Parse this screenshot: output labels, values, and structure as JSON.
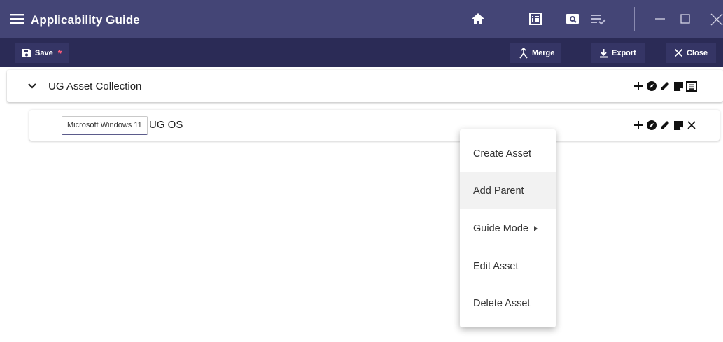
{
  "window": {
    "title": "Applicability Guide"
  },
  "toolbar": {
    "save_label": "Save",
    "unsaved_marker": "*",
    "merge_label": "Merge",
    "export_label": "Export",
    "close_label": "Close"
  },
  "tree": {
    "root": {
      "label": "UG Asset Collection"
    },
    "child": {
      "chip": "Microsoft Windows 11",
      "label": "UG OS"
    }
  },
  "context_menu": {
    "items": [
      {
        "label": "Create Asset"
      },
      {
        "label": "Add Parent"
      },
      {
        "label": "Guide Mode"
      },
      {
        "label": "Edit Asset"
      },
      {
        "label": "Delete Asset"
      }
    ]
  },
  "colors": {
    "titlebar": "#444576",
    "toolbar": "#2b2b56",
    "accent_star": "#ff5a7a"
  }
}
